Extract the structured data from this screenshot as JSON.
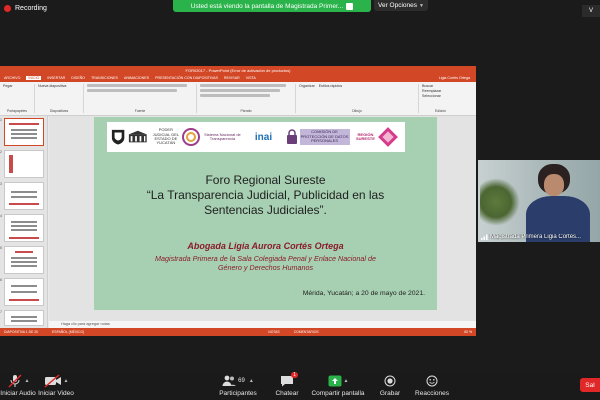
{
  "recording": {
    "label": "Recording"
  },
  "share_banner": {
    "text": "Usted está viendo la pantalla de Magistrada Primer..."
  },
  "view_options": {
    "label": "Ver Opciones"
  },
  "view_button": {
    "label": "V"
  },
  "ppt": {
    "title": "FOR02017 - PowerPoint (Error de activación de productos)",
    "user": "Ligia Cortés Ortega",
    "tabs": [
      "ARCHIVO",
      "INICIO",
      "INSERTAR",
      "DISEÑO",
      "TRANSICIONES",
      "ANIMACIONES",
      "PRESENTACIÓN CON DIAPOSITIVAS",
      "REVISAR",
      "VISTA"
    ],
    "ribbon": {
      "paste": "Pegar",
      "clipboard": "Portapapeles",
      "slides": "Diapositivas",
      "font": "Fuente",
      "paragraph": "Párrafo",
      "drawing": "Dibujo",
      "editing": "Edición",
      "new_slide": "Nueva diapositiva",
      "organize": "Organizar",
      "quick_styles": "Estilos rápidos",
      "find": "Buscar",
      "replace": "Reemplazar",
      "select": "Seleccionar"
    },
    "thumb_numbers": [
      "1",
      "2",
      "3",
      "4",
      "5",
      "6",
      "7"
    ],
    "notes_placeholder": "Haga clic para agregar notas",
    "status": {
      "slide": "DIAPOSITIVA 1 DE 20",
      "lang": "ESPAÑOL (MÉXICO)",
      "notes": "NOTAS",
      "comments": "COMENTARIOS",
      "zoom": "60 %"
    }
  },
  "slide": {
    "logos": [
      "PODER JUDICIAL DEL ESTADO DE YUCATÁN",
      "Sistema Nacional de Transparencia",
      "inai",
      "COMISIÓN DE PROTECCIÓN DE DATOS PERSONALES",
      "REGIÓN SURESTE"
    ],
    "title_line1": "Foro Regional Sureste",
    "title_line2": "“La Transparencia Judicial, Publicidad en las",
    "title_line3": "Sentencias Judiciales”.",
    "speaker_name": "Abogada Ligia Aurora Cortés Ortega",
    "speaker_role_line1": "Magistrada Primera de la Sala Colegiada Penal y Enlace Nacional de",
    "speaker_role_line2": "Género  y Derechos Humanos",
    "date": "Mérida, Yucatán; a 20 de mayo de 2021."
  },
  "video": {
    "participant_name": "Magistrada Primera Ligia Cortés..."
  },
  "toolbar": {
    "audio_label": "Iniciar Audio",
    "video_label": "Iniciar Video",
    "participants_label": "Participantes",
    "participants_count": "69",
    "chat_label": "Chatear",
    "chat_badge": "1",
    "share_label": "Compartir pantalla",
    "record_label": "Grabar",
    "reactions_label": "Reacciones",
    "end_label": "Sal"
  },
  "colors": {
    "ppt_orange": "#d24726",
    "slide_green": "#a7d0b2",
    "share_green": "#29b34a",
    "zoom_red": "#e02828"
  }
}
